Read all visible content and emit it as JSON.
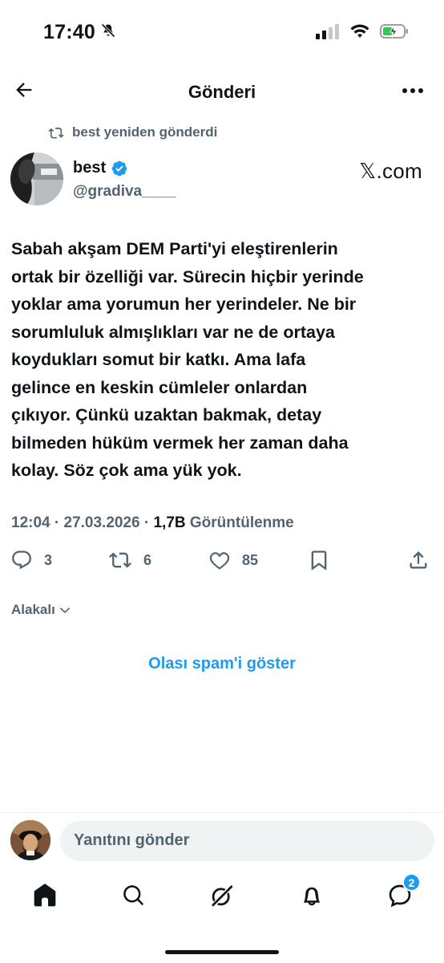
{
  "status_bar": {
    "time": "17:40"
  },
  "header": {
    "title": "Gönderi"
  },
  "repost": {
    "text": "best yeniden gönderdi"
  },
  "author": {
    "name": "best",
    "handle": "@gradiva____",
    "source": "𝕏.com"
  },
  "tweet": {
    "lines": [
      "Sabah akşam DEM Parti'yi eleştirenlerin",
      "ortak bir özelliği var. Sürecin hiçbir yerinde",
      "yoklar ama yorumun her yerindeler. Ne bir",
      "sorumluluk almışlıkları var ne de ortaya",
      "koydukları somut bir katkı. Ama lafa",
      "gelince en keskin cümleler onlardan",
      "çıkıyor. Çünkü uzaktan bakmak, detay",
      "bilmeden hüküm vermek her zaman daha",
      "kolay. Söz çok ama yük yok."
    ]
  },
  "meta": {
    "time": "12:04",
    "date": "27.03.2026",
    "views_count": "1,7B",
    "views_label": "Görüntülenme",
    "separator": "·"
  },
  "actions": {
    "replies": "3",
    "reposts": "6",
    "likes": "85"
  },
  "related": {
    "label": "Alakalı"
  },
  "spam": {
    "label": "Olası spam'i göster"
  },
  "reply": {
    "placeholder": "Yanıtını gönder"
  },
  "tabs": {
    "messages_badge": "2"
  },
  "colors": {
    "accent": "#1d9bf0",
    "text": "#0f1419",
    "muted": "#536471",
    "battery": "#34c759"
  }
}
